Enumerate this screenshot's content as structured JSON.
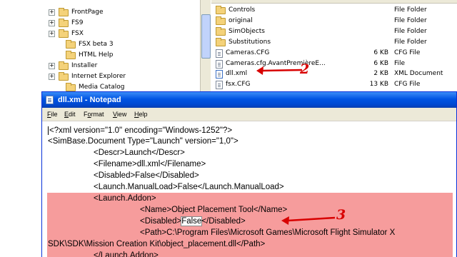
{
  "explorer": {
    "tree": [
      {
        "label": "FrontPage",
        "expander": "+"
      },
      {
        "label": "FS9",
        "expander": "+"
      },
      {
        "label": "FSX",
        "expander": "+"
      },
      {
        "label": "FSX beta 3",
        "expander": ""
      },
      {
        "label": "HTML Help",
        "expander": ""
      },
      {
        "label": "Installer",
        "expander": "+"
      },
      {
        "label": "Internet Explorer",
        "expander": "+"
      },
      {
        "label": "Media Catalog",
        "expander": ""
      }
    ],
    "files": [
      {
        "name": "Controls",
        "size": "",
        "type": "File Folder",
        "icon": "folder-icon"
      },
      {
        "name": "original",
        "size": "",
        "type": "File Folder",
        "icon": "folder-icon"
      },
      {
        "name": "SimObjects",
        "size": "",
        "type": "File Folder",
        "icon": "folder-icon"
      },
      {
        "name": "Substitutions",
        "size": "",
        "type": "File Folder",
        "icon": "folder-icon"
      },
      {
        "name": "Cameras.CFG",
        "size": "6 KB",
        "type": "CFG File",
        "icon": "file-icon"
      },
      {
        "name": "Cameras.cfg.AvantPremièreE...",
        "size": "6 KB",
        "type": "File",
        "icon": "file-icon"
      },
      {
        "name": "dll.xml",
        "size": "2 KB",
        "type": "XML Document",
        "icon": "file-icon"
      },
      {
        "name": "fsx.CFG",
        "size": "13 KB",
        "type": "CFG File",
        "icon": "file-icon"
      }
    ],
    "annotation_2": "2"
  },
  "notepad": {
    "title": "dll.xml - Notepad",
    "menu": [
      {
        "key": "F",
        "rest": "ile"
      },
      {
        "key": "E",
        "rest": "dit"
      },
      {
        "key": "",
        "rest": "Format",
        "u_index": 1
      },
      {
        "key": "V",
        "rest": "iew"
      },
      {
        "key": "H",
        "rest": "elp"
      }
    ],
    "lines": [
      "<?xml version=\"1.0\" encoding=\"Windows-1252\"?>",
      "<SimBase.Document Type=\"Launch\" version=\"1,0\">",
      "<Descr>Launch</Descr>",
      "<Filename>dll.xml</Filename>",
      "<Disabled>False</Disabled>",
      "<Launch.ManualLoad>False</Launch.ManualLoad>",
      "<Launch.Addon>",
      "<Name>Object Placement Tool</Name>",
      "<Disabled>",
      "False",
      "</Disabled>",
      "<Path>C:\\Program Files\\Microsoft Games\\Microsoft Flight Simulator X",
      "SDK\\SDK\\Mission Creation Kit\\object_placement.dll</Path>",
      "</Launch.Addon>"
    ],
    "annotation_3": "3"
  },
  "colors": {
    "highlight": "#f69c9c",
    "annotation": "#d80000",
    "titlebar": "#0054e3"
  }
}
